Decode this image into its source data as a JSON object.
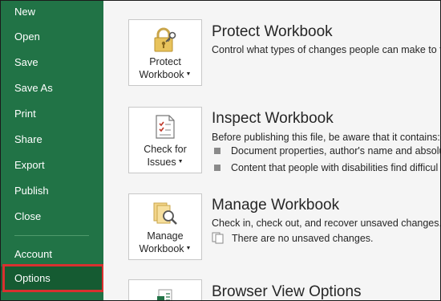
{
  "sidebar": {
    "items": [
      {
        "id": "new",
        "label": "New"
      },
      {
        "id": "open",
        "label": "Open"
      },
      {
        "id": "save",
        "label": "Save"
      },
      {
        "id": "save-as",
        "label": "Save As"
      },
      {
        "id": "print",
        "label": "Print"
      },
      {
        "id": "share",
        "label": "Share"
      },
      {
        "id": "export",
        "label": "Export"
      },
      {
        "id": "publish",
        "label": "Publish"
      },
      {
        "id": "close",
        "label": "Close"
      }
    ],
    "account_label": "Account",
    "options_label": "Options"
  },
  "protect": {
    "button_line1": "Protect",
    "button_line2": "Workbook",
    "title": "Protect Workbook",
    "description": "Control what types of changes people can make to th"
  },
  "inspect": {
    "button_line1": "Check for",
    "button_line2": "Issues",
    "title": "Inspect Workbook",
    "description": "Before publishing this file, be aware that it contains:",
    "bullets": [
      "Document properties, author's name and absolu",
      "Content that people with disabilities find difficul"
    ]
  },
  "manage": {
    "button_line1": "Manage",
    "button_line2": "Workbook",
    "title": "Manage Workbook",
    "description": "Check in, check out, and recover unsaved changes.",
    "status": "There are no unsaved changes."
  },
  "browser": {
    "title": "Browser View Options"
  },
  "colors": {
    "sidebar_bg": "#217346",
    "sidebar_selected": "#155b32",
    "highlight_border": "#d9302f",
    "content_bg": "#f5f5f5"
  },
  "icons": {
    "protect": "padlock-key-icon",
    "inspect": "checklist-icon",
    "manage": "document-magnifier-icon",
    "status": "documents-icon",
    "browser": "excel-document-icon"
  }
}
